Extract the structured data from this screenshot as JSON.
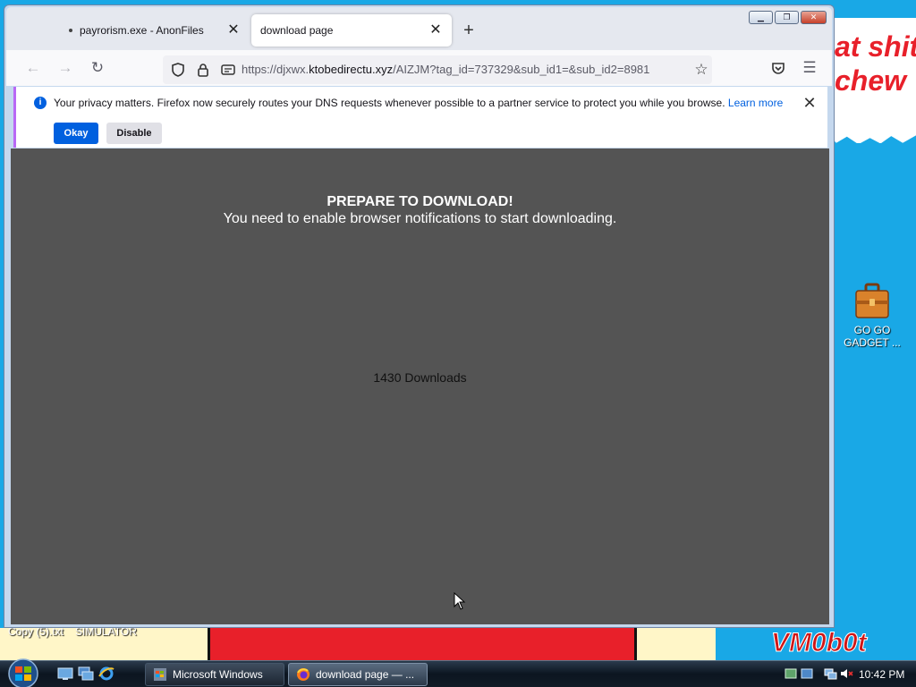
{
  "window": {
    "tabs": [
      {
        "title": "payrorism.exe - AnonFiles",
        "active": false
      },
      {
        "title": "download page",
        "active": true
      }
    ],
    "url": {
      "prefix": "https://djxwx.",
      "domain": "ktobedirectu.xyz",
      "path": "/AIZJM?tag_id=737329&sub_id1=&sub_id2=8981"
    },
    "window_buttons": {
      "minimize": "▁",
      "restore": "❐",
      "close": "✕"
    }
  },
  "notification": {
    "message": "Your privacy matters. Firefox now securely routes your DNS requests whenever possible to a partner service to protect you while you browse.",
    "link": "Learn more",
    "okay_label": "Okay",
    "disable_label": "Disable"
  },
  "page": {
    "title": "PREPARE TO DOWNLOAD!",
    "subtitle": "You need to enable browser notifications to start downloading.",
    "downloads": "1430 Downloads"
  },
  "desktop": {
    "wallpaper_line1": "at shit",
    "wallpaper_line2": "chew",
    "signature": "VM0b0t",
    "icon_label_1": "GO GO",
    "icon_label_2": "GADGET ...",
    "file_label_1": "Copy (5).txt",
    "file_label_2": "SIMULATOR"
  },
  "taskbar": {
    "tasks": [
      {
        "title": "Microsoft Windows"
      },
      {
        "title": "download page — ..."
      }
    ],
    "clock": "10:42 PM"
  },
  "colors": {
    "accent": "#0060df",
    "page_bg": "#545454",
    "desktop_bg": "#19a8e6"
  }
}
